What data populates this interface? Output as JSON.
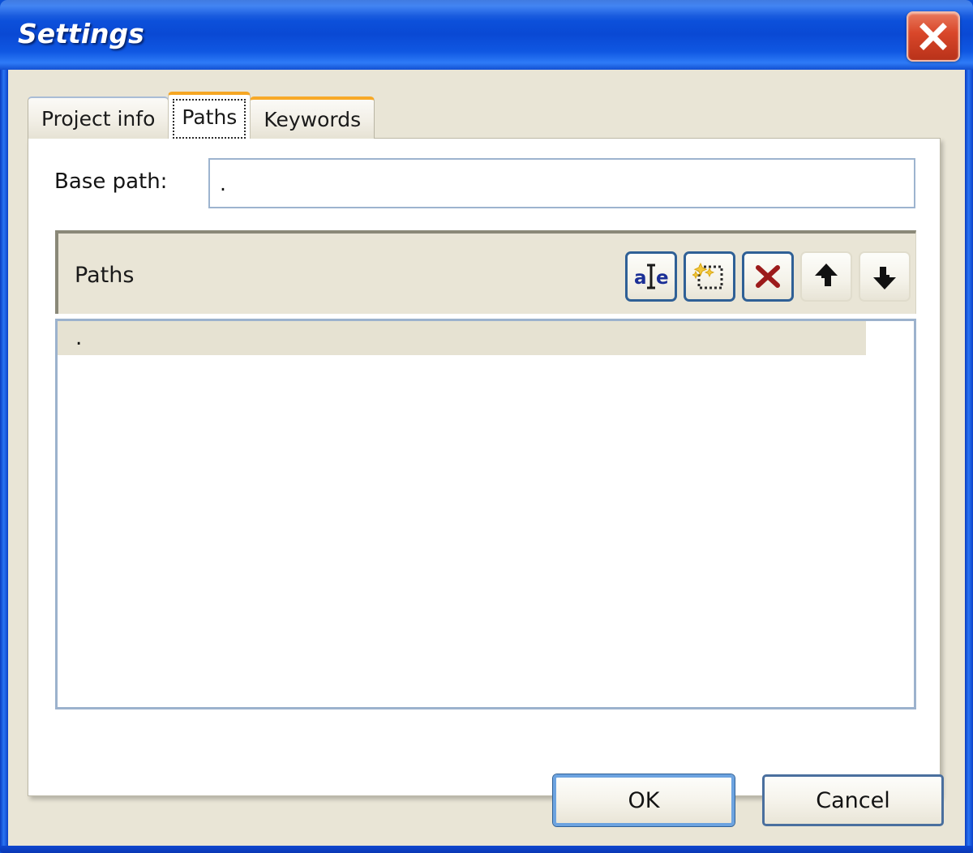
{
  "window": {
    "title": "Settings",
    "close_icon": "close-x-icon",
    "titlebar_color": "#0d53dd",
    "close_button_color": "#d9472a",
    "body_color": "#e9e5d6"
  },
  "tabs": [
    {
      "label": "Project info",
      "selected": false
    },
    {
      "label": "Paths",
      "selected": true
    },
    {
      "label": "Keywords",
      "selected": false
    }
  ],
  "accent_color": "#f5a623",
  "base_path": {
    "label": "Base path:",
    "value": ".",
    "placeholder": ""
  },
  "paths_group": {
    "label": "Paths",
    "toolbar": [
      {
        "name": "rename-icon",
        "tooltip": "Rename",
        "enabled": true
      },
      {
        "name": "new-path-icon",
        "tooltip": "New",
        "enabled": true
      },
      {
        "name": "delete-icon",
        "tooltip": "Delete",
        "enabled": true
      },
      {
        "name": "move-up-icon",
        "tooltip": "Move up",
        "enabled": false
      },
      {
        "name": "move-down-icon",
        "tooltip": "Move down",
        "enabled": false
      }
    ]
  },
  "paths_list": {
    "items": [
      {
        "value": ".",
        "selected": true
      }
    ],
    "selection_color": "#e6e2d2"
  },
  "footer": {
    "ok_label": "OK",
    "cancel_label": "Cancel"
  }
}
